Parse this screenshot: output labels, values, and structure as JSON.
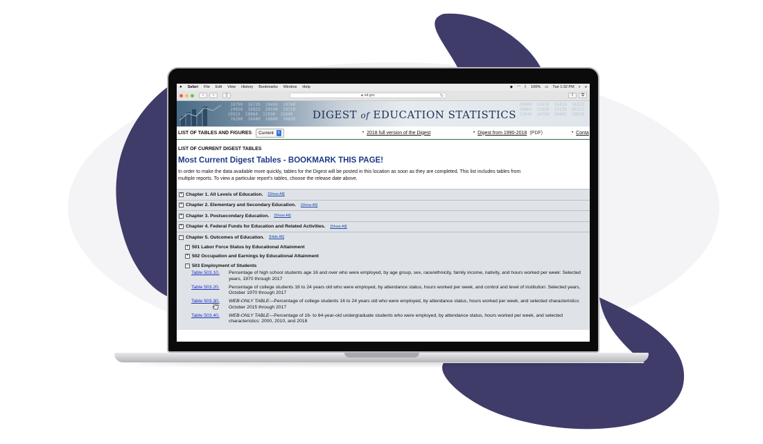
{
  "menubar": {
    "app": "Safari",
    "items": [
      "File",
      "Edit",
      "View",
      "History",
      "Bookmarks",
      "Window",
      "Help"
    ],
    "battery": "100%",
    "clock": "Tue 1:32 PM"
  },
  "toolbar": {
    "url": "ed.gov"
  },
  "banner": {
    "title_prefix": "Digest",
    "title_of": "of",
    "title_suffix": "Education Statistics"
  },
  "nav": {
    "list_label": "LIST OF TABLES AND FIGURES",
    "select_value": "Current",
    "link1": "2018 full version of the Digest",
    "link2": "Digest from 1990-2018",
    "link2_suffix": "(PDF)",
    "link3": "Conta"
  },
  "content": {
    "list_title": "LIST OF CURRENT DIGEST TABLES",
    "main_title": "Most Current Digest Tables - BOOKMARK THIS PAGE!",
    "intro_line1": "In order to make the data available more quickly, tables for the Digest will be posted in this location as soon as they are completed. This list includes tables from",
    "intro_line2": "multiple reports. To view a particular report's tables, choose the release date above."
  },
  "chapters": [
    {
      "label": "Chapter 1.  All Levels of Education.",
      "toggle": "[Show All]",
      "box": "+"
    },
    {
      "label": "Chapter 2.  Elementary and Secondary Education.",
      "toggle": "[Show All]",
      "box": "+"
    },
    {
      "label": "Chapter 3.  Postsecondary Education.",
      "toggle": "[Show All]",
      "box": "+"
    },
    {
      "label": "Chapter 4.  Federal Funds for Education and Related Activities.",
      "toggle": "[Show All]",
      "box": "+"
    },
    {
      "label": "Chapter 5.  Outcomes of Education.",
      "toggle": "[Hide All]",
      "box": "−"
    }
  ],
  "subsections": [
    {
      "label": "501 Labor Force Status by Educational Attainment",
      "box": "+"
    },
    {
      "label": "502 Occupation and Earnings by Educational Attainment",
      "box": "+"
    },
    {
      "label": "503 Employment of Students",
      "box": "−"
    }
  ],
  "tables": [
    {
      "id": "Table 503.10.",
      "prefix": "",
      "desc": "Percentage of high school students age 16 and over who were employed, by age group, sex, race/ethnicity, family income, nativity, and hours worked per week: Selected years, 1970 through 2017"
    },
    {
      "id": "Table 503.20.",
      "prefix": "",
      "desc": "Percentage of college students 16 to 24 years old who were employed, by attendance status, hours worked per week, and control and level of institution: Selected years, October 1970 through 2017"
    },
    {
      "id": "Table 503.30.",
      "prefix": "WEB-ONLY TABLE",
      "desc": "—Percentage of college students 16 to 24 years old who were employed, by attendance status, hours worked per week, and selected characteristics: October 2015 through 2017"
    },
    {
      "id": "Table 503.40.",
      "prefix": "WEB-ONLY TABLE",
      "desc": "—Percentage of 16- to 64-year-old undergraduate students who were employed, by attendance status, hours worked per week, and selected characteristics: 2000, 2010, and 2018"
    }
  ],
  "colors": {
    "blob": "#3f3c6a",
    "oval": "#f4f4f6",
    "title_blue": "#1a3a86",
    "link_blue": "#1a2fc0",
    "chapter_bg": "#dfe3e8"
  },
  "icons": [
    "apple-icon",
    "wifi-icon",
    "battery-icon",
    "search-icon",
    "lock-icon",
    "reload-icon",
    "share-icon",
    "tabs-icon",
    "back-icon",
    "forward-icon",
    "sidebar-icon",
    "cursor-icon"
  ]
}
